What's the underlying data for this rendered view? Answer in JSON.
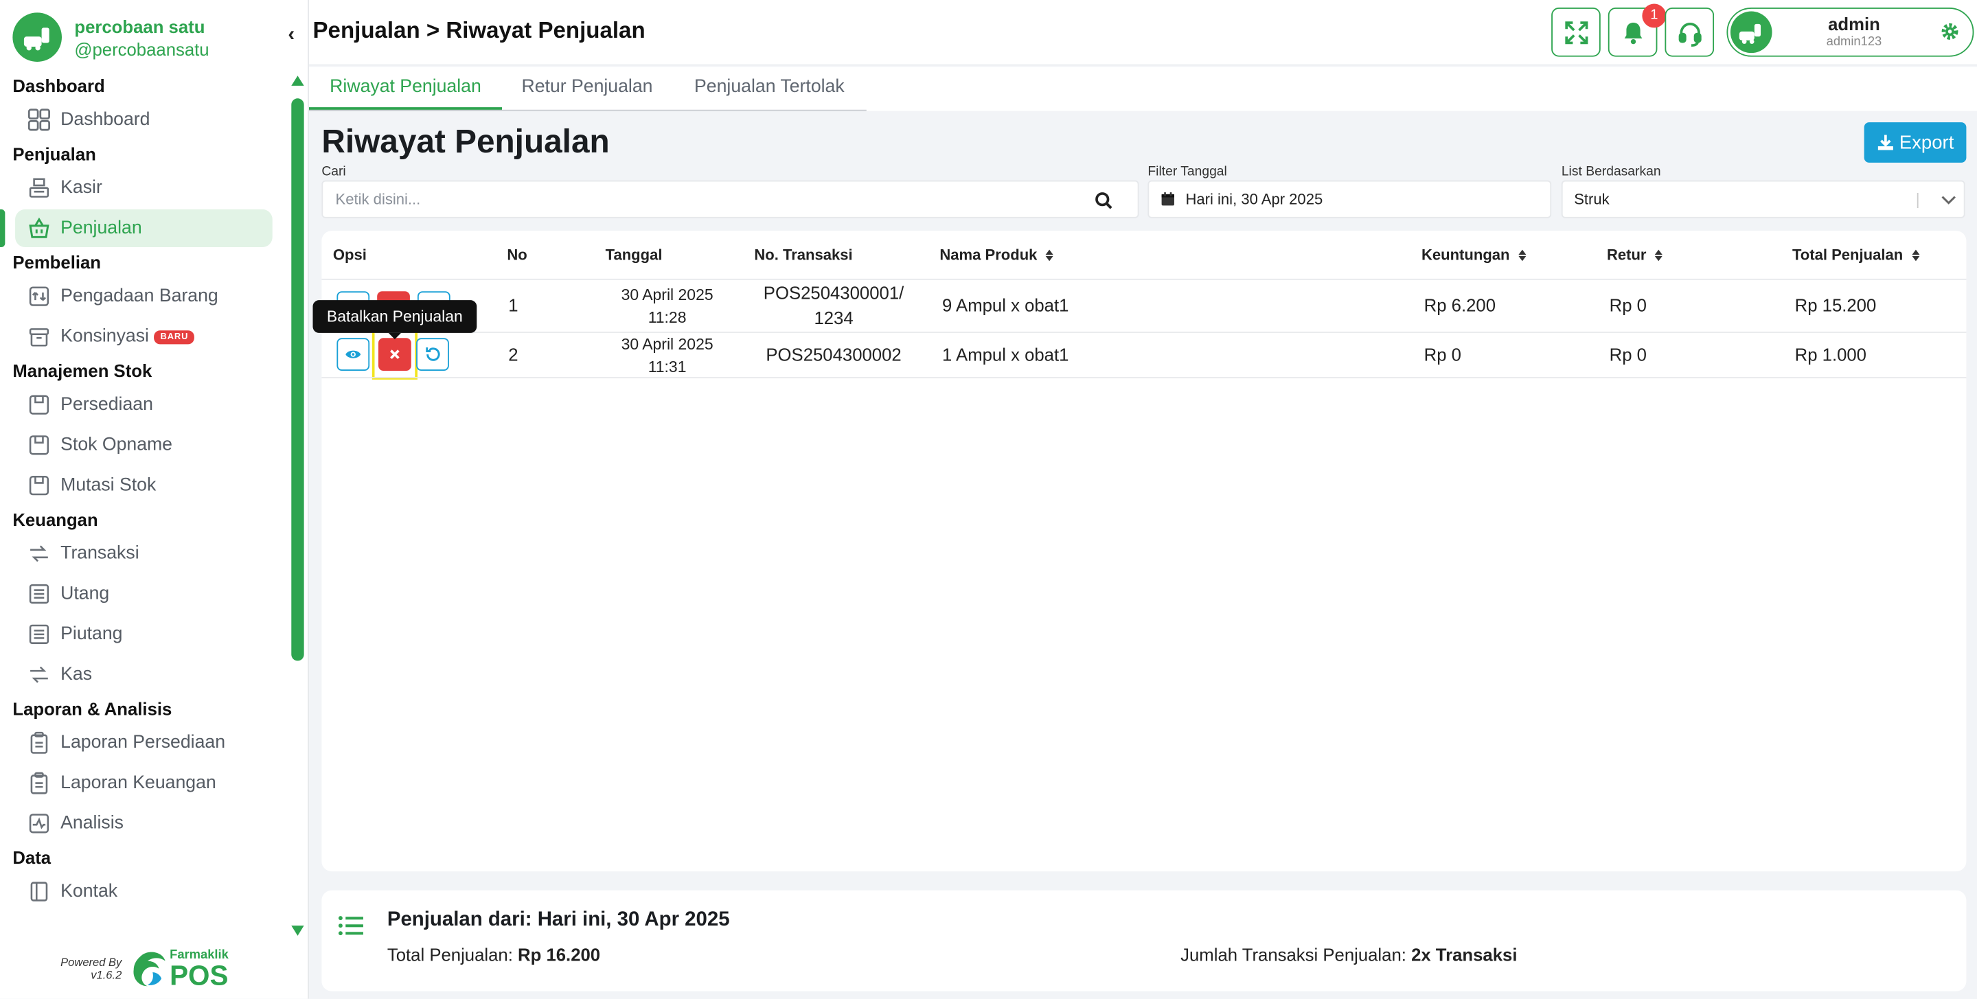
{
  "brand": {
    "name": "percobaan satu",
    "handle": "@percobaansatu"
  },
  "sidebar": {
    "sections": [
      {
        "title": "Dashboard",
        "items": [
          {
            "label": "Dashboard",
            "icon": "grid-icon"
          }
        ]
      },
      {
        "title": "Penjualan",
        "items": [
          {
            "label": "Kasir",
            "icon": "register-icon"
          },
          {
            "label": "Penjualan",
            "icon": "basket-icon",
            "active": true
          }
        ]
      },
      {
        "title": "Pembelian",
        "items": [
          {
            "label": "Pengadaan Barang",
            "icon": "procurement-icon"
          },
          {
            "label": "Konsinyasi",
            "icon": "box-icon",
            "badge": "BARU"
          }
        ]
      },
      {
        "title": "Manajemen Stok",
        "items": [
          {
            "label": "Persediaan",
            "icon": "stock-icon"
          },
          {
            "label": "Stok Opname",
            "icon": "stock-icon"
          },
          {
            "label": "Mutasi Stok",
            "icon": "stock-icon"
          }
        ]
      },
      {
        "title": "Keuangan",
        "items": [
          {
            "label": "Transaksi",
            "icon": "exchange-icon"
          },
          {
            "label": "Utang",
            "icon": "ledger-icon"
          },
          {
            "label": "Piutang",
            "icon": "ledger-icon"
          },
          {
            "label": "Kas",
            "icon": "exchange-icon"
          }
        ]
      },
      {
        "title": "Laporan & Analisis",
        "items": [
          {
            "label": "Laporan Persediaan",
            "icon": "clipboard-icon"
          },
          {
            "label": "Laporan Keuangan",
            "icon": "clipboard-icon"
          },
          {
            "label": "Analisis",
            "icon": "pulse-icon"
          }
        ]
      },
      {
        "title": "Data",
        "items": [
          {
            "label": "Kontak",
            "icon": "contact-book-icon"
          }
        ]
      }
    ],
    "powered_by": "Powered By",
    "version": "v1.6.2",
    "partner_small": "Farmaklik",
    "partner_big": "POS"
  },
  "header": {
    "title": "Penjualan > Riwayat Penjualan",
    "notification_count": "1",
    "user_name": "admin",
    "user_id": "admin123"
  },
  "tabs": [
    "Riwayat Penjualan",
    "Retur Penjualan",
    "Penjualan Tertolak"
  ],
  "main": {
    "title": "Riwayat Penjualan",
    "export_label": "Export",
    "search_label": "Cari",
    "search_placeholder": "Ketik disini...",
    "date_label": "Filter Tanggal",
    "date_value": "Hari ini, 30 Apr 2025",
    "list_label": "List Berdasarkan",
    "list_value": "Struk"
  },
  "table": {
    "headers": [
      "Opsi",
      "No",
      "Tanggal",
      "No. Transaksi",
      "Nama Produk",
      "Keuntungan",
      "Retur",
      "Total Penjualan"
    ],
    "rows": [
      {
        "no": "1",
        "date": "30 April 2025",
        "time": "11:28",
        "trx1": "POS2504300001/",
        "trx2": "1234",
        "product": "9 Ampul x obat1",
        "profit": "Rp 6.200",
        "retur": "Rp 0",
        "total": "Rp 15.200"
      },
      {
        "no": "2",
        "date": "30 April 2025",
        "time": "11:31",
        "trx1": "POS2504300002",
        "trx2": "",
        "product": "1 Ampul x obat1",
        "profit": "Rp 0",
        "retur": "Rp 0",
        "total": "Rp 1.000"
      }
    ],
    "tooltip": "Batalkan Penjualan"
  },
  "summary": {
    "title": "Penjualan dari: Hari ini, 30 Apr 2025",
    "total_label": "Total Penjualan:",
    "total_value": "Rp 16.200",
    "count_label": "Jumlah Transaksi Penjualan:",
    "count_value": "2x Transaksi"
  },
  "colors": {
    "brand_green": "#2ea44f",
    "export_blue": "#1aa0d6",
    "cancel_red": "#e53e3e",
    "highlight_yellow": "#f2e51e"
  }
}
